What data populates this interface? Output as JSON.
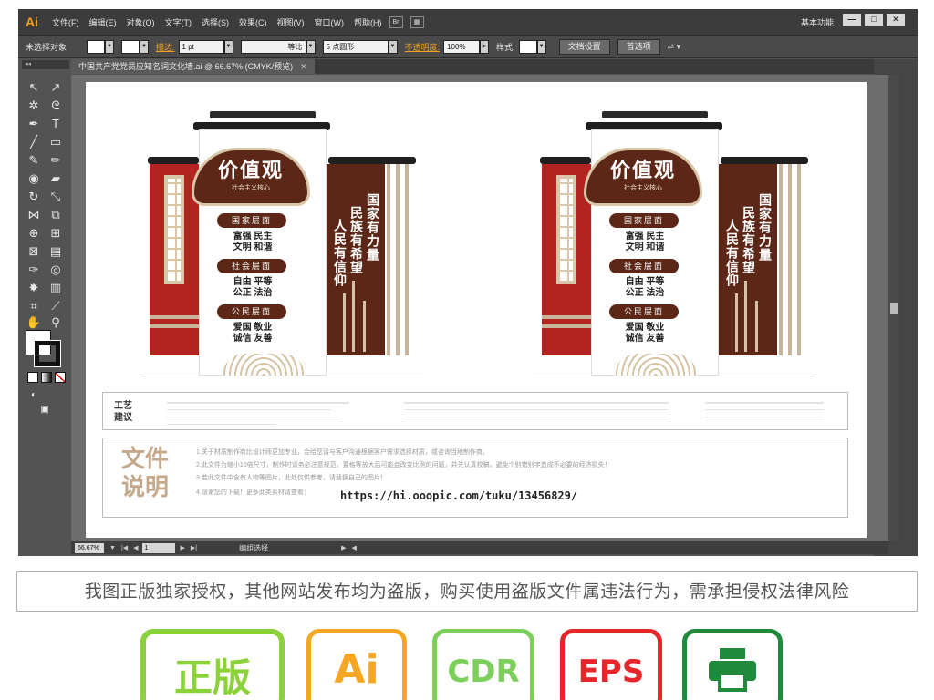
{
  "app": {
    "logo": "Ai",
    "menu": [
      "文件(F)",
      "编辑(E)",
      "对象(O)",
      "文字(T)",
      "选择(S)",
      "效果(C)",
      "视图(V)",
      "窗口(W)",
      "帮助(H)"
    ],
    "bridge_label": "Br",
    "workspace": "基本功能",
    "window_controls": [
      "—",
      "□",
      "✕"
    ]
  },
  "controlbar": {
    "selection_status": "未选择对象",
    "stroke_label": "描边:",
    "stroke_weight": "1 pt",
    "stroke_profile": "等比",
    "brush": "5 点圆形",
    "opacity_label": "不透明度:",
    "opacity_value": "100%",
    "style_label": "样式:",
    "doc_settings": "文档设置",
    "preferences": "首选项"
  },
  "document": {
    "tab_title": "中国共产党党员应知名词文化墙.ai @ 66.67% (CMYK/预览)",
    "tab_close": "✕"
  },
  "statusbar": {
    "zoom": "66.67%",
    "page": "1",
    "status": "编组选择"
  },
  "artwork": {
    "badge_title": "价值观",
    "badge_subtitle": "社会主义核心",
    "levels": [
      {
        "name": "国家层面",
        "line1": "富强  民主",
        "line2": "文明  和谐"
      },
      {
        "name": "社会层面",
        "line1": "自由  平等",
        "line2": "公正  法治"
      },
      {
        "name": "公民层面",
        "line1": "爱国  敬业",
        "line2": "诚信  友善"
      }
    ],
    "slogan_col1": "国家有力量",
    "slogan_col2": "民族有希望",
    "slogan_col3": "人民有信仰",
    "spec_label": "工艺\n建议",
    "notes_title": "文件\n说明",
    "notes": [
      "1.关于材质制作商比设计师更加专业，会给您请与客户沟通根据客户需求选择材质，或咨询当地制作商。",
      "2.此文件为缩小10倍尺寸，制作时请务必注意规范，置格等放大后可能会改变比例的问题，并先认真校稿，避免个别错别字造成不必要的经济损失！",
      "3.若此文件中含有人物等图片，此处仅供参考，请替换自己的图片！",
      "4.感谢您的下载！更多此类素材请查看："
    ],
    "notes_url": "https://hi.ooopic.com/tuku/13456829/"
  },
  "copyright": "我图正版独家授权，其他网站发布均为盗版，购买使用盗版文件属违法行为，需承担侵权法律风险",
  "formats": [
    {
      "label": "正版",
      "color": "#8bd23a"
    },
    {
      "label": "Ai",
      "color": "#f5a623"
    },
    {
      "label": "CDR",
      "color": "#7ccf5a"
    },
    {
      "label": "EPS",
      "color": "#e5262b"
    },
    {
      "label": "print-icon",
      "color": "#1f8a3c"
    }
  ],
  "colors": {
    "wall_brown": "#5c2716",
    "wall_red": "#b32421",
    "accent_beige": "#c6b59a",
    "illustrator_orange": "#f4a01f"
  }
}
